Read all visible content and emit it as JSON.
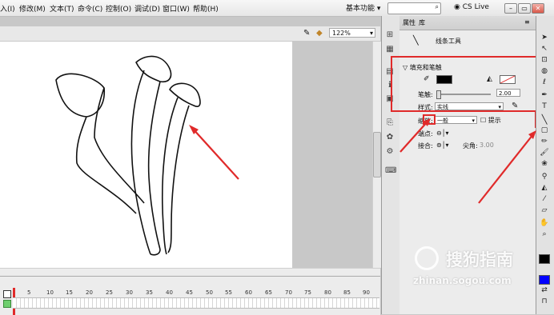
{
  "menu": {
    "items": [
      "入(I)",
      "修改(M)",
      "文本(T)",
      "命令(C)",
      "控制(O)",
      "调试(D)",
      "窗口(W)",
      "帮助(H)"
    ],
    "workspace": "基本功能",
    "cslive": "CS Live"
  },
  "stagebar": {
    "zoom": "122%"
  },
  "timeline": {
    "frame_numbers": [
      "5",
      "10",
      "15",
      "20",
      "25",
      "30",
      "35",
      "40",
      "45",
      "50",
      "55",
      "60",
      "65",
      "70",
      "75",
      "80",
      "85",
      "90"
    ]
  },
  "panel": {
    "tab_properties": "属性",
    "tab_library": "库",
    "tool_name": "线条工具",
    "section_title": "填充和笔触",
    "stroke_label": "笔触:",
    "stroke_value": "2.00",
    "style_label": "样式:",
    "style_value": "实线",
    "scale_label": "缩放:",
    "scale_value": "一般",
    "hint_label": "提示",
    "cap_label": "端点:",
    "join_label": "接合:",
    "miter_label": "尖角:",
    "miter_value": "3.00"
  },
  "colors": {
    "stroke": "#000000",
    "fill_swatch": "#ffffff",
    "highlight": "#e02a2a",
    "fill_tool": "#000000",
    "stroke_tool": "#0000ff"
  },
  "watermark": {
    "brand": "搜狗指南",
    "url": "zhinan.sogou.com"
  }
}
